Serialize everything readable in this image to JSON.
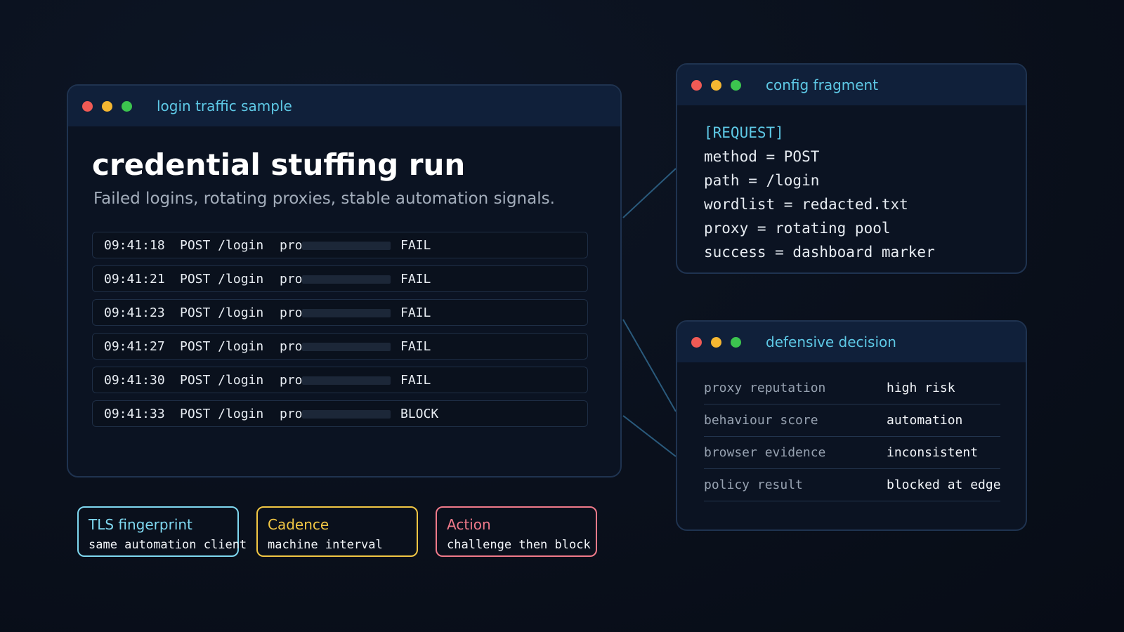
{
  "main_window": {
    "title": "login traffic sample",
    "heading": "credential stuffing run",
    "subheading": "Failed logins, rotating proxies, stable automation signals.",
    "log_rows": [
      {
        "time": "09:41:18",
        "method_path": "POST /login",
        "proxy": "pro",
        "result": "FAIL"
      },
      {
        "time": "09:41:21",
        "method_path": "POST /login",
        "proxy": "pro",
        "result": "FAIL"
      },
      {
        "time": "09:41:23",
        "method_path": "POST /login",
        "proxy": "pro",
        "result": "FAIL"
      },
      {
        "time": "09:41:27",
        "method_path": "POST /login",
        "proxy": "pro",
        "result": "FAIL"
      },
      {
        "time": "09:41:30",
        "method_path": "POST /login",
        "proxy": "pro",
        "result": "FAIL"
      },
      {
        "time": "09:41:33",
        "method_path": "POST /login",
        "proxy": "pro",
        "result": "BLOCK"
      }
    ]
  },
  "config_window": {
    "title": "config fragment",
    "section": "[REQUEST]",
    "lines": [
      "method = POST",
      "path = /login",
      "wordlist = redacted.txt",
      "proxy = rotating pool",
      "success = dashboard marker"
    ]
  },
  "decision_window": {
    "title": "defensive decision",
    "rows": [
      {
        "key": "proxy reputation",
        "value": "high risk"
      },
      {
        "key": "behaviour score",
        "value": "automation"
      },
      {
        "key": "browser evidence",
        "value": "inconsistent"
      },
      {
        "key": "policy result",
        "value": "blocked at edge"
      }
    ]
  },
  "tags": [
    {
      "title": "TLS fingerprint",
      "subtitle": "same automation client",
      "color": "#7fd8f0"
    },
    {
      "title": "Cadence",
      "subtitle": "machine interval",
      "color": "#f2c744"
    },
    {
      "title": "Action",
      "subtitle": "challenge then block",
      "color": "#f07a8a"
    }
  ],
  "colors": {
    "dot_red": "#f05a55",
    "dot_yellow": "#f5b731",
    "dot_green": "#3cc44f",
    "accent": "#5ec9e6",
    "connector": "#2a5a7c"
  }
}
